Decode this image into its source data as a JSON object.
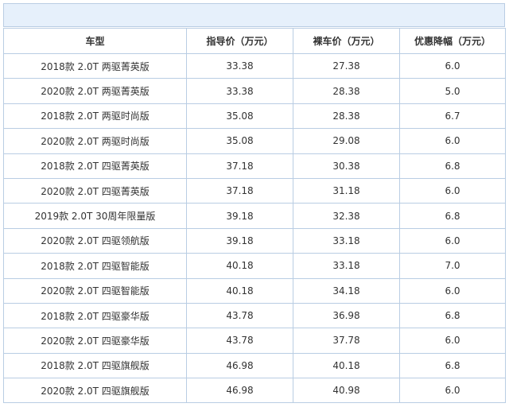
{
  "table": {
    "headers": [
      "车型",
      "指导价（万元）",
      "裸车价（万元）",
      "优惠降幅（万元）"
    ],
    "rows": [
      [
        "2018款 2.0T 两驱菁英版",
        "33.38",
        "27.38",
        "6.0"
      ],
      [
        "2020款 2.0T 两驱菁英版",
        "33.38",
        "28.38",
        "5.0"
      ],
      [
        "2018款 2.0T 两驱时尚版",
        "35.08",
        "28.38",
        "6.7"
      ],
      [
        "2020款 2.0T 两驱时尚版",
        "35.08",
        "29.08",
        "6.0"
      ],
      [
        "2018款 2.0T 四驱菁英版",
        "37.18",
        "30.38",
        "6.8"
      ],
      [
        "2020款 2.0T 四驱菁英版",
        "37.18",
        "31.18",
        "6.0"
      ],
      [
        "2019款 2.0T 30周年限量版",
        "39.18",
        "32.38",
        "6.8"
      ],
      [
        "2020款 2.0T 四驱领航版",
        "39.18",
        "33.18",
        "6.0"
      ],
      [
        "2018款 2.0T 四驱智能版",
        "40.18",
        "33.18",
        "7.0"
      ],
      [
        "2020款 2.0T 四驱智能版",
        "40.18",
        "34.18",
        "6.0"
      ],
      [
        "2018款 2.0T 四驱豪华版",
        "43.78",
        "36.98",
        "6.8"
      ],
      [
        "2020款 2.0T 四驱豪华版",
        "43.78",
        "37.78",
        "6.0"
      ],
      [
        "2018款 2.0T 四驱旗舰版",
        "46.98",
        "40.18",
        "6.8"
      ],
      [
        "2020款 2.0T 四驱旗舰版",
        "46.98",
        "40.98",
        "6.0"
      ]
    ]
  },
  "colors": {
    "header_band": "#e6f0fb",
    "border": "#b9cde3",
    "text": "#333333"
  }
}
